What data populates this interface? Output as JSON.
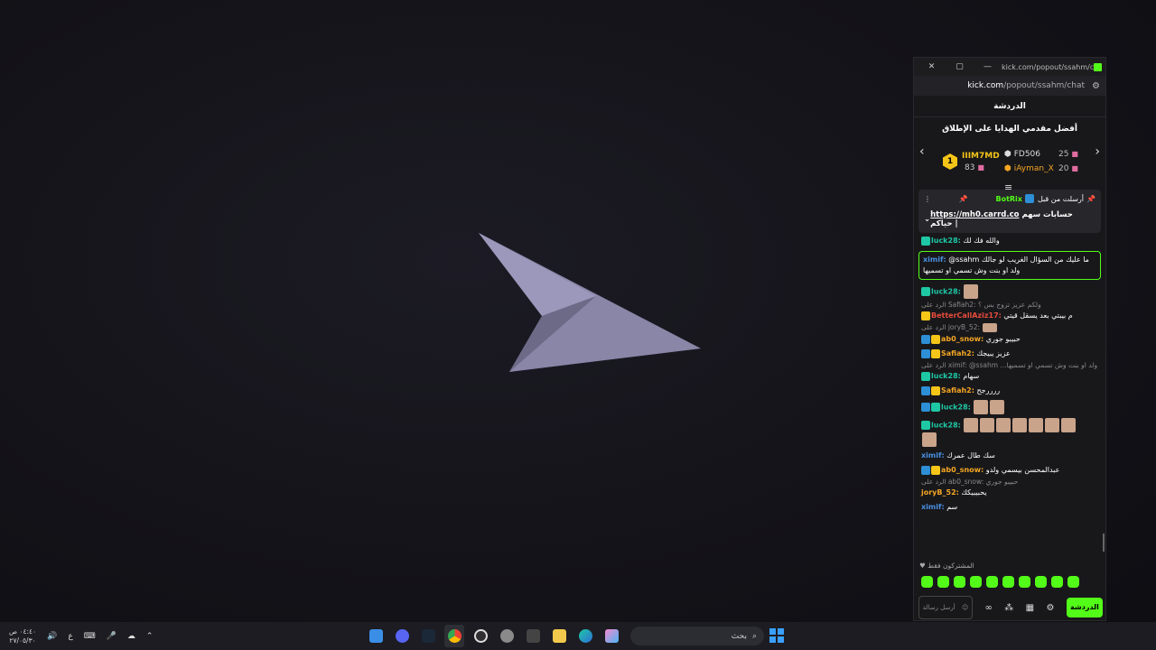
{
  "window": {
    "tab_url": "kick.com/popout/ssahm/ch...",
    "address_host": "kick.com",
    "address_path": "/popout/ssahm/chat",
    "icons": [
      "close-icon",
      "maximize-icon",
      "minimize-icon",
      "kick-icon",
      "tune-icon"
    ]
  },
  "chat": {
    "title": "الدردشة",
    "top_gifters_title": "أفضل مقدمي الهدايا على الإطلاق",
    "gifters": [
      {
        "rank": "1",
        "name": "IIIM7MD",
        "count": "83"
      },
      {
        "name": "FD506",
        "count": "25"
      },
      {
        "name": "iAyman_X",
        "count": "20"
      }
    ],
    "pinned": {
      "sent_by": "أرسلت من قبل",
      "author": "BotRix",
      "text": "حسابات سهم حياكم |",
      "link": "https://mh0.carrd.co"
    },
    "messages": [
      {
        "user": "luck28:",
        "text": "والله فك لك",
        "color": "#1ec8a5"
      },
      {
        "user": "ximif:",
        "text": "@ssahm ما عليك من السؤال الغريب لو جالك ولد او بنت وش تسمي او تسميها",
        "color": "#4a90e2",
        "highlight": true
      },
      {
        "user": "luck28:",
        "text": "",
        "emotes": 1,
        "color": "#1ec8a5"
      },
      {
        "reply": "الرد على Safiah2: ولكم عزيز تزوج بس ؟"
      },
      {
        "user": "BetterCallAziz17:",
        "text": "م بيبتي بعد يسقل قيتي",
        "color": "#e74c3c"
      },
      {
        "reply": "الرد على joryB_52:"
      },
      {
        "user": "ab0_snow:",
        "text": "حبيبو جوري",
        "color": "#f5a623"
      },
      {
        "user": "Safiah2:",
        "text": "عزيز يبيجك",
        "color": "#f5a623"
      },
      {
        "reply": "الرد على ximif: @ssahm ...ولد او بنت وش تسمي او تسميها"
      },
      {
        "user": "luck28:",
        "text": "سهام",
        "color": "#1ec8a5"
      },
      {
        "user": "Safiah2:",
        "text": "ررررجح",
        "color": "#f5a623"
      },
      {
        "user": "luck28:",
        "text": "",
        "emotes": 2,
        "color": "#1ec8a5"
      },
      {
        "user": "luck28:",
        "text": "",
        "emotes": 8,
        "color": "#1ec8a5"
      },
      {
        "user": "ximif:",
        "text": "سك طال عمرك",
        "color": "#4a90e2"
      },
      {
        "user": "ab0_snow:",
        "text": "عبدالمحسن بيسمي ولدو",
        "color": "#f5a623"
      },
      {
        "reply": "الرد على ab0_snow: حبيبو جوري"
      },
      {
        "user": "joryB_52:",
        "text": "يحبيبيكك",
        "color": "#f5a623"
      },
      {
        "user": "ximif:",
        "text": "سم",
        "color": "#4a90e2"
      }
    ],
    "subscribers_only": "المشتركون فقط",
    "send_label": "الدردشة",
    "input_placeholder": "أرسل رسالة"
  },
  "taskbar": {
    "time": "٠٤:٤٠ ص",
    "date": "٢٧/٠٥/٣٠",
    "lang": "ع",
    "search_placeholder": "بحث",
    "apps": [
      "maps-icon",
      "discord-icon",
      "steam-icon",
      "chrome-icon",
      "obs-icon",
      "settings-icon",
      "store-icon",
      "explorer-icon",
      "edge-icon",
      "copilot-icon"
    ]
  }
}
